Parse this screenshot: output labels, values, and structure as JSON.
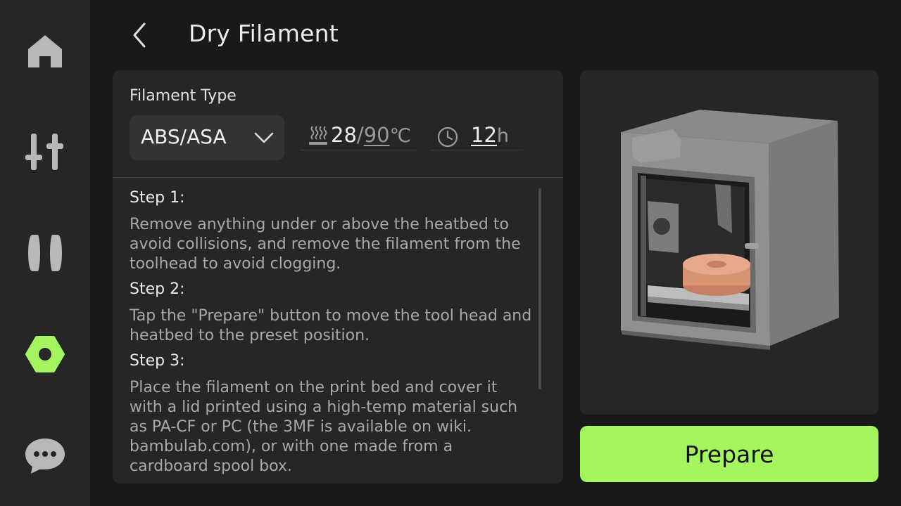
{
  "sidebar": {
    "items": [
      {
        "icon": "home-icon",
        "active": false
      },
      {
        "icon": "controls-icon",
        "active": false
      },
      {
        "icon": "filament-icon",
        "active": false
      },
      {
        "icon": "utilities-nut-icon",
        "active": true
      },
      {
        "icon": "messages-icon",
        "active": false
      }
    ],
    "active_color": "#a5f55f",
    "inactive_color": "#b8b8b8"
  },
  "header": {
    "title": "Dry Filament"
  },
  "filament": {
    "label": "Filament Type",
    "selected_type": "ABS/ASA"
  },
  "temperature": {
    "current": "28",
    "separator": "/",
    "target": "90",
    "unit": "℃"
  },
  "duration": {
    "value": "12",
    "unit": "h"
  },
  "steps": [
    {
      "title": "Step 1:",
      "body": "Remove anything under or above the heatbed to avoid collisions, and remove the filament from the toolhead to avoid clogging."
    },
    {
      "title": "Step 2:",
      "body": "Tap the \"Prepare\" button to move the tool head and heatbed to the preset position."
    },
    {
      "title": "Step 3:",
      "body": "Place the filament on the print bed and cover it with a lid printed using a high-temp material such as PA-CF or PC (the 3MF is available on wiki. bambulab.com), or with one made from a cardboard spool box."
    }
  ],
  "actions": {
    "prepare_label": "Prepare",
    "prepare_color": "#a5f55f"
  }
}
